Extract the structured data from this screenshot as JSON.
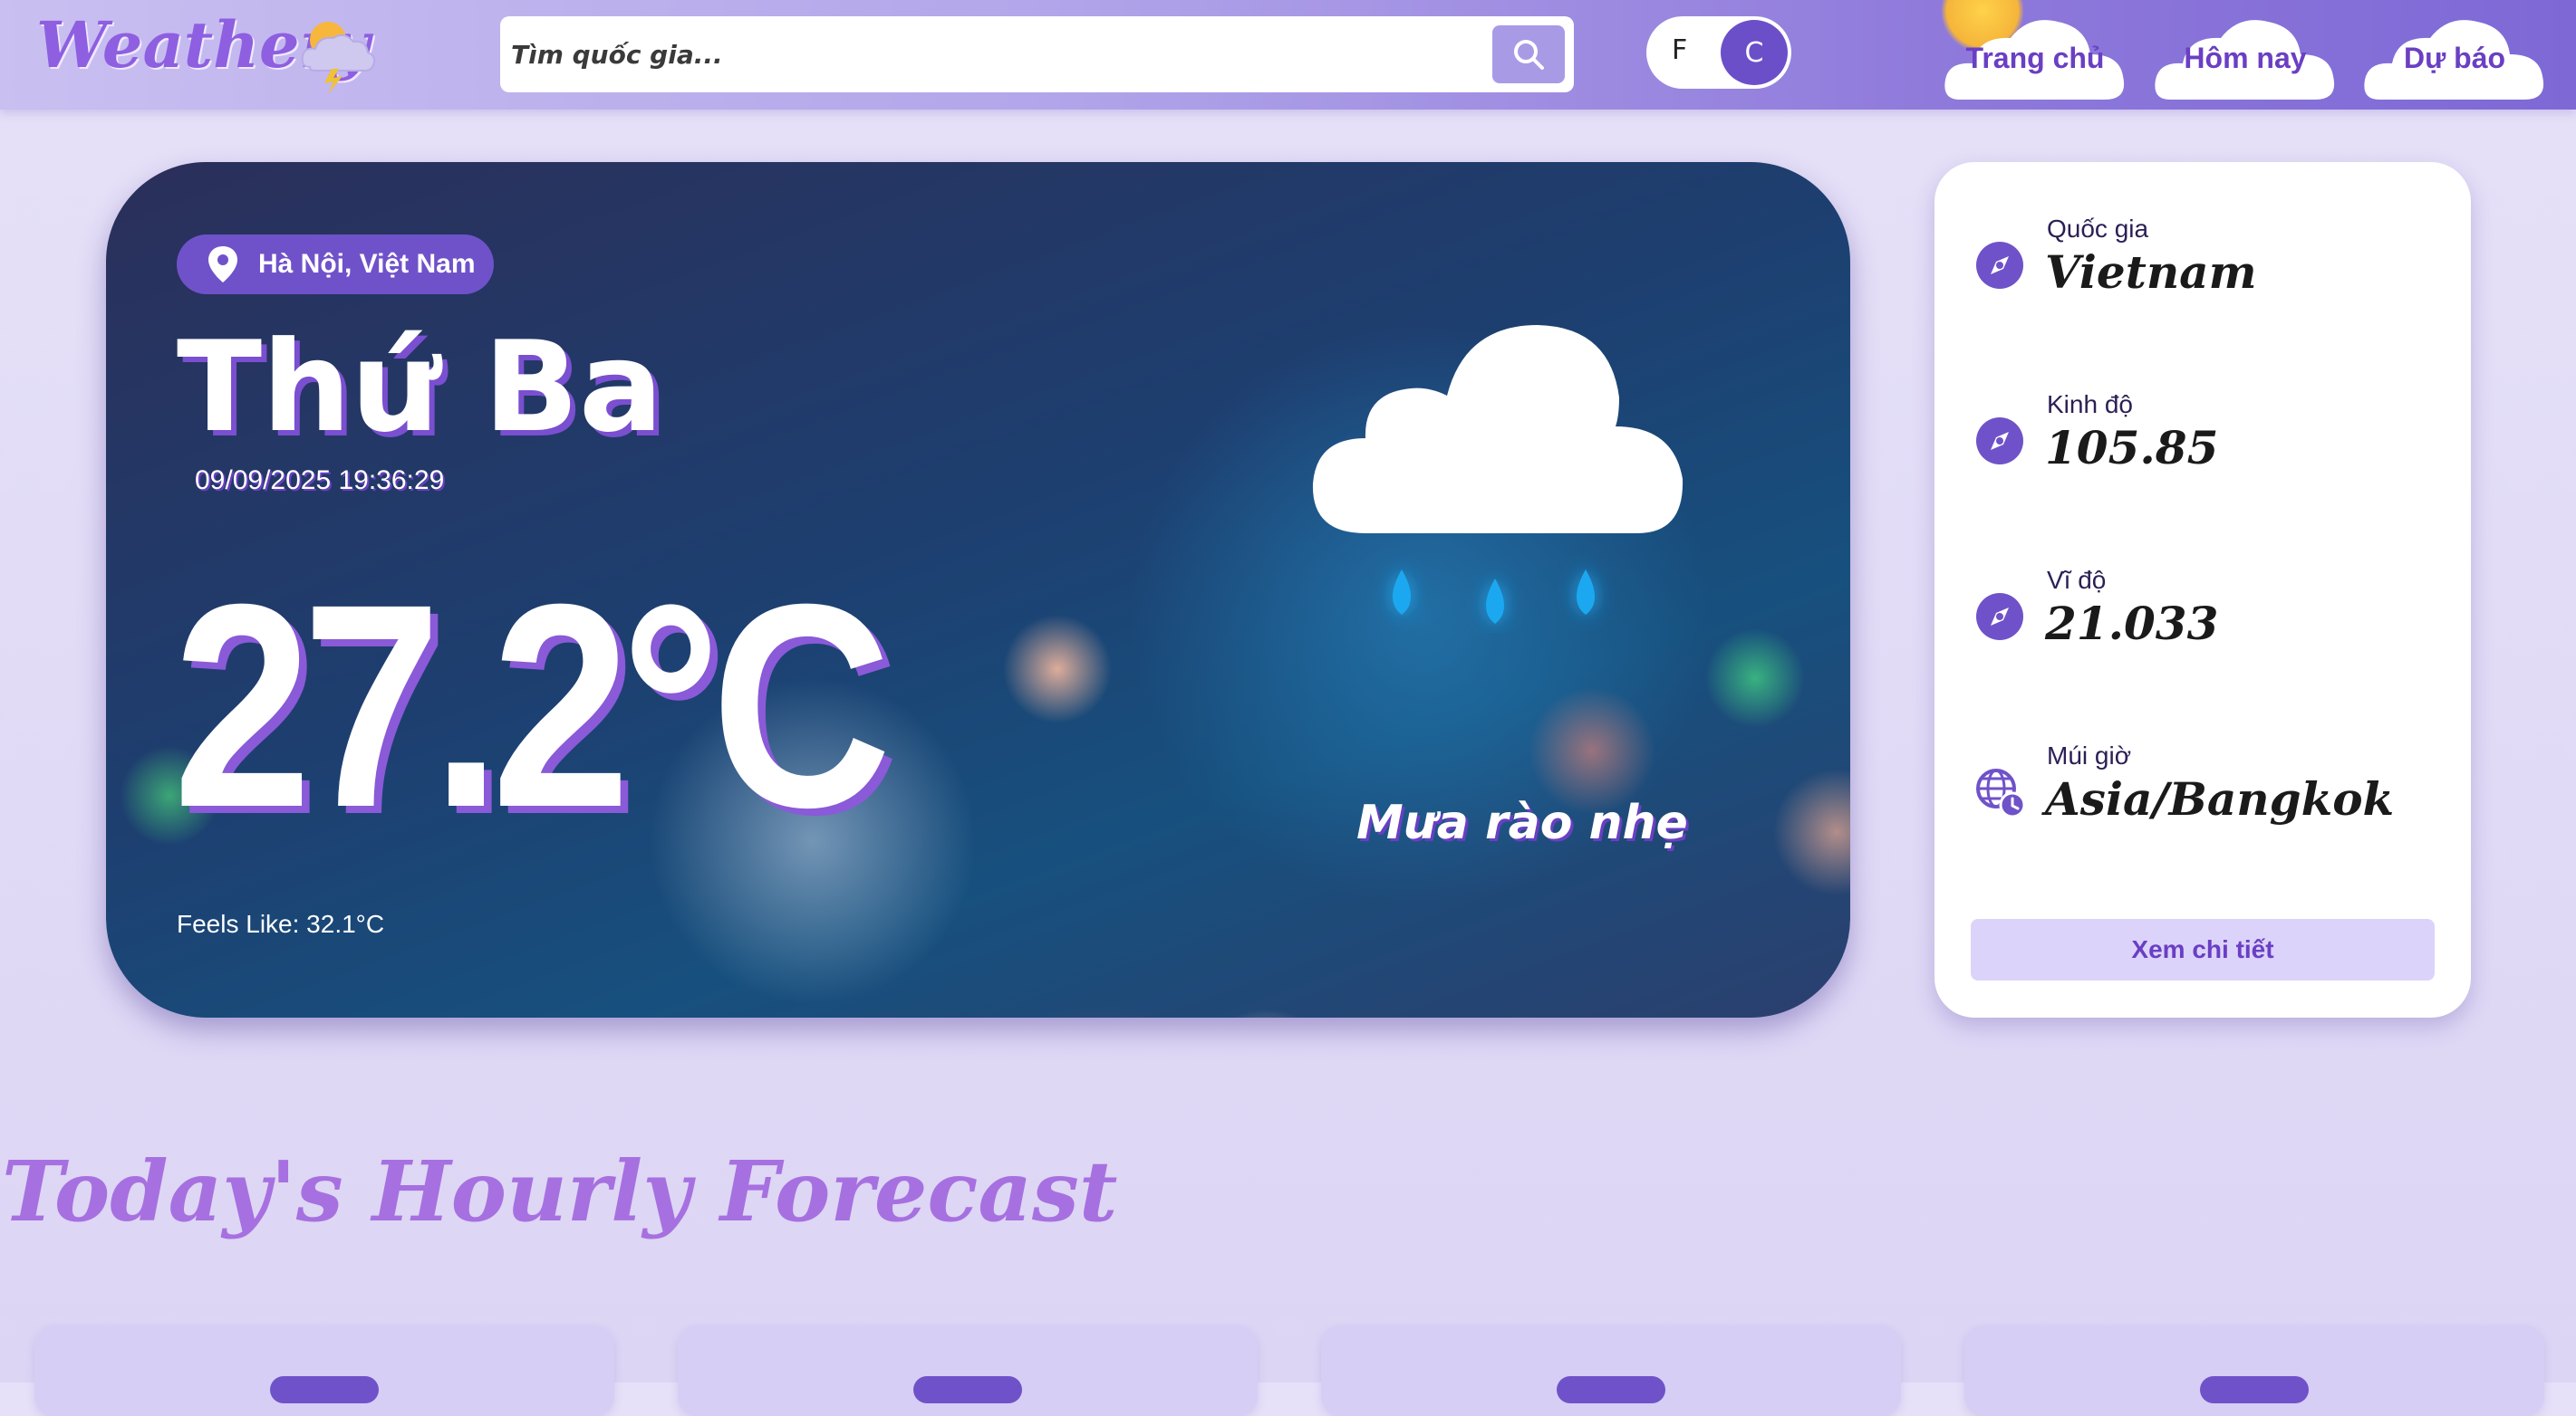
{
  "header": {
    "logo_text": "Weathery",
    "search": {
      "placeholder": "Tìm quốc gia..."
    },
    "unit_toggle": {
      "f_label": "F",
      "c_label": "C",
      "selected": "C"
    },
    "nav": [
      {
        "label": "Trang chủ"
      },
      {
        "label": "Hôm nay"
      },
      {
        "label": "Dự báo"
      }
    ]
  },
  "weather": {
    "location": "Hà Nội, Việt Nam",
    "day": "Thứ Ba",
    "datetime": "09/09/2025 19:36:29",
    "temperature": "27.2°C",
    "feels_like": "Feels Like: 32.1°C",
    "condition": "Mưa rào nhẹ",
    "icon": "rain-cloud-icon"
  },
  "info": {
    "country": {
      "label": "Quốc gia",
      "value": "Vietnam"
    },
    "longitude": {
      "label": "Kinh độ",
      "value": "105.85"
    },
    "latitude": {
      "label": "Vĩ độ",
      "value": "21.033"
    },
    "timezone": {
      "label": "Múi giờ",
      "value": "Asia/Bangkok"
    },
    "detail_button": "Xem chi tiết"
  },
  "hourly": {
    "title": "Today's Hourly Forecast"
  },
  "colors": {
    "accent": "#6f52c9",
    "brand": "#8e5fe0",
    "background": "#e2dcf7"
  }
}
